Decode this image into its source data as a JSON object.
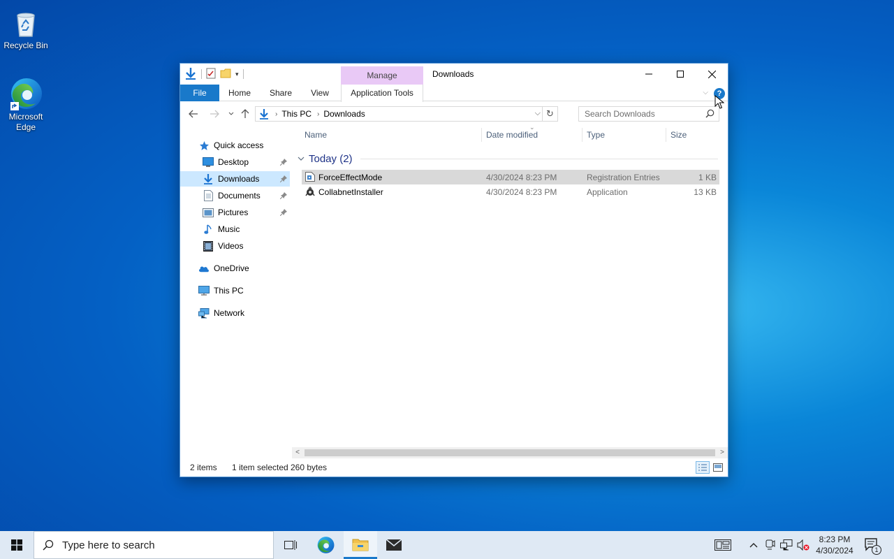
{
  "desktop": {
    "icons": [
      {
        "label": "Recycle Bin",
        "icon": "recycle-bin-icon"
      },
      {
        "label": "Microsoft Edge",
        "icon": "edge-icon"
      }
    ]
  },
  "window": {
    "title": "Downloads",
    "context_tab": "Manage",
    "ribbon_tabs": [
      "File",
      "Home",
      "Share",
      "View",
      "Application Tools"
    ],
    "help_label": "?",
    "controls": {
      "minimize": "minimize-icon",
      "maximize": "maximize-icon",
      "close": "close-icon"
    },
    "accent": "#1979ca",
    "context_color": "#e9c9f6"
  },
  "address": {
    "crumbs": [
      "This PC",
      "Downloads"
    ],
    "search_placeholder": "Search Downloads"
  },
  "navpane": {
    "quick_access": "Quick access",
    "items": [
      {
        "label": "Desktop",
        "icon": "desktop-folder-icon",
        "pinned": true
      },
      {
        "label": "Downloads",
        "icon": "downloads-folder-icon",
        "pinned": true,
        "selected": true
      },
      {
        "label": "Documents",
        "icon": "documents-folder-icon",
        "pinned": true
      },
      {
        "label": "Pictures",
        "icon": "pictures-folder-icon",
        "pinned": true
      },
      {
        "label": "Music",
        "icon": "music-folder-icon"
      },
      {
        "label": "Videos",
        "icon": "videos-folder-icon"
      }
    ],
    "onedrive": "OneDrive",
    "this_pc": "This PC",
    "network": "Network"
  },
  "filelist": {
    "columns": [
      "Name",
      "Date modified",
      "Type",
      "Size"
    ],
    "group": "Today (2)",
    "rows": [
      {
        "name": "ForceEffectMode",
        "date": "4/30/2024 8:23 PM",
        "type": "Registration Entries",
        "size": "1 KB",
        "selected": true
      },
      {
        "name": "CollabnetInstaller",
        "date": "4/30/2024 8:23 PM",
        "type": "Application",
        "size": "13 KB"
      }
    ]
  },
  "status": {
    "count": "2 items",
    "selected": "1 item selected",
    "size": "260 bytes"
  },
  "taskbar": {
    "search_placeholder": "Type here to search",
    "time": "8:23 PM",
    "date": "4/30/2024",
    "notification_count": "1",
    "bg": "#dfe9f4"
  }
}
